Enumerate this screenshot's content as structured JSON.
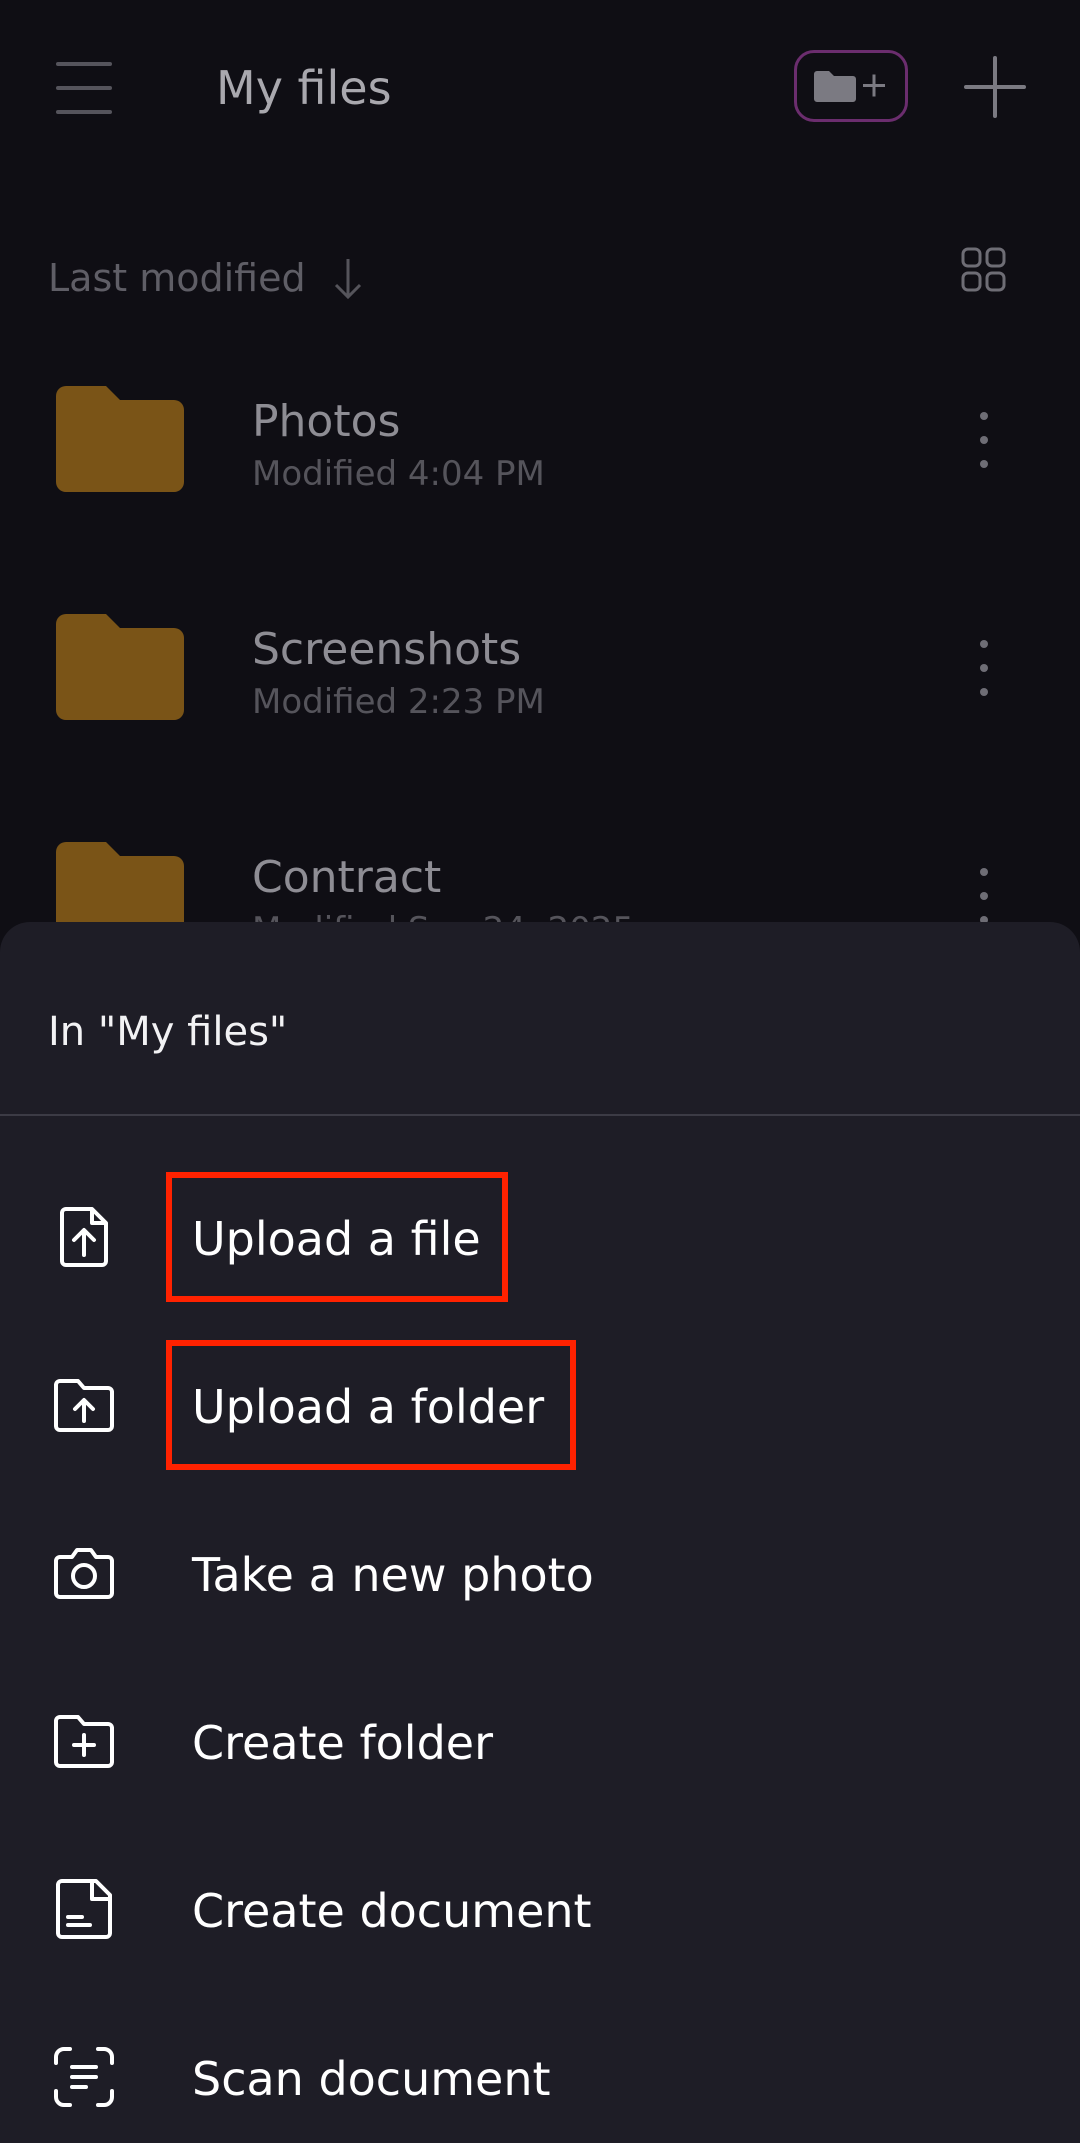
{
  "header": {
    "title": "My files",
    "menu_icon": "hamburger-menu-icon",
    "new_folder_icon": "folder-plus-icon",
    "add_icon": "plus-icon",
    "accent_border_color": "#6b2d6e"
  },
  "sort": {
    "label": "Last modified",
    "direction_icon": "arrow-down-icon",
    "view_toggle_icon": "grid-view-icon"
  },
  "files": [
    {
      "name": "Photos",
      "meta": "Modified 4:04 PM",
      "icon": "folder-icon"
    },
    {
      "name": "Screenshots",
      "meta": "Modified 2:23 PM",
      "icon": "folder-icon"
    },
    {
      "name": "Contract",
      "meta": "Modified Sep 24, 2025",
      "icon": "folder-icon"
    }
  ],
  "folder_color": "#7a5417",
  "sheet": {
    "title": "In \"My files\"",
    "actions": [
      {
        "label": "Upload a file",
        "icon": "file-upload-icon",
        "highlighted": true
      },
      {
        "label": "Upload a folder",
        "icon": "folder-upload-icon",
        "highlighted": true
      },
      {
        "label": "Take a new photo",
        "icon": "camera-icon",
        "highlighted": false
      },
      {
        "label": "Create folder",
        "icon": "folder-add-icon",
        "highlighted": false
      },
      {
        "label": "Create document",
        "icon": "document-icon",
        "highlighted": false
      },
      {
        "label": "Scan document",
        "icon": "scan-icon",
        "highlighted": false
      }
    ]
  },
  "highlight_color": "#ff2200"
}
